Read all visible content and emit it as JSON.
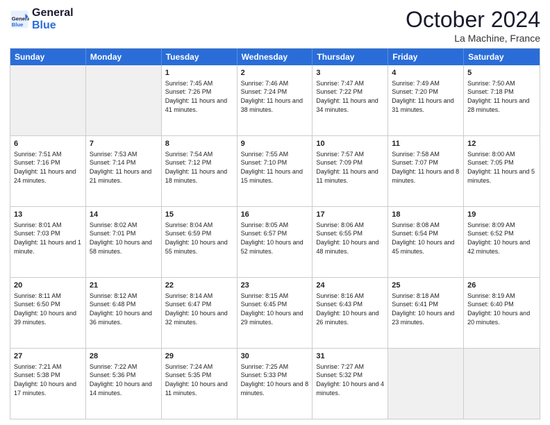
{
  "logo": {
    "line1": "General",
    "line2": "Blue"
  },
  "header": {
    "month": "October 2024",
    "location": "La Machine, France"
  },
  "days": [
    "Sunday",
    "Monday",
    "Tuesday",
    "Wednesday",
    "Thursday",
    "Friday",
    "Saturday"
  ],
  "rows": [
    [
      {
        "day": "",
        "info": ""
      },
      {
        "day": "",
        "info": ""
      },
      {
        "day": "1",
        "info": "Sunrise: 7:45 AM\nSunset: 7:26 PM\nDaylight: 11 hours and 41 minutes."
      },
      {
        "day": "2",
        "info": "Sunrise: 7:46 AM\nSunset: 7:24 PM\nDaylight: 11 hours and 38 minutes."
      },
      {
        "day": "3",
        "info": "Sunrise: 7:47 AM\nSunset: 7:22 PM\nDaylight: 11 hours and 34 minutes."
      },
      {
        "day": "4",
        "info": "Sunrise: 7:49 AM\nSunset: 7:20 PM\nDaylight: 11 hours and 31 minutes."
      },
      {
        "day": "5",
        "info": "Sunrise: 7:50 AM\nSunset: 7:18 PM\nDaylight: 11 hours and 28 minutes."
      }
    ],
    [
      {
        "day": "6",
        "info": "Sunrise: 7:51 AM\nSunset: 7:16 PM\nDaylight: 11 hours and 24 minutes."
      },
      {
        "day": "7",
        "info": "Sunrise: 7:53 AM\nSunset: 7:14 PM\nDaylight: 11 hours and 21 minutes."
      },
      {
        "day": "8",
        "info": "Sunrise: 7:54 AM\nSunset: 7:12 PM\nDaylight: 11 hours and 18 minutes."
      },
      {
        "day": "9",
        "info": "Sunrise: 7:55 AM\nSunset: 7:10 PM\nDaylight: 11 hours and 15 minutes."
      },
      {
        "day": "10",
        "info": "Sunrise: 7:57 AM\nSunset: 7:09 PM\nDaylight: 11 hours and 11 minutes."
      },
      {
        "day": "11",
        "info": "Sunrise: 7:58 AM\nSunset: 7:07 PM\nDaylight: 11 hours and 8 minutes."
      },
      {
        "day": "12",
        "info": "Sunrise: 8:00 AM\nSunset: 7:05 PM\nDaylight: 11 hours and 5 minutes."
      }
    ],
    [
      {
        "day": "13",
        "info": "Sunrise: 8:01 AM\nSunset: 7:03 PM\nDaylight: 11 hours and 1 minute."
      },
      {
        "day": "14",
        "info": "Sunrise: 8:02 AM\nSunset: 7:01 PM\nDaylight: 10 hours and 58 minutes."
      },
      {
        "day": "15",
        "info": "Sunrise: 8:04 AM\nSunset: 6:59 PM\nDaylight: 10 hours and 55 minutes."
      },
      {
        "day": "16",
        "info": "Sunrise: 8:05 AM\nSunset: 6:57 PM\nDaylight: 10 hours and 52 minutes."
      },
      {
        "day": "17",
        "info": "Sunrise: 8:06 AM\nSunset: 6:55 PM\nDaylight: 10 hours and 48 minutes."
      },
      {
        "day": "18",
        "info": "Sunrise: 8:08 AM\nSunset: 6:54 PM\nDaylight: 10 hours and 45 minutes."
      },
      {
        "day": "19",
        "info": "Sunrise: 8:09 AM\nSunset: 6:52 PM\nDaylight: 10 hours and 42 minutes."
      }
    ],
    [
      {
        "day": "20",
        "info": "Sunrise: 8:11 AM\nSunset: 6:50 PM\nDaylight: 10 hours and 39 minutes."
      },
      {
        "day": "21",
        "info": "Sunrise: 8:12 AM\nSunset: 6:48 PM\nDaylight: 10 hours and 36 minutes."
      },
      {
        "day": "22",
        "info": "Sunrise: 8:14 AM\nSunset: 6:47 PM\nDaylight: 10 hours and 32 minutes."
      },
      {
        "day": "23",
        "info": "Sunrise: 8:15 AM\nSunset: 6:45 PM\nDaylight: 10 hours and 29 minutes."
      },
      {
        "day": "24",
        "info": "Sunrise: 8:16 AM\nSunset: 6:43 PM\nDaylight: 10 hours and 26 minutes."
      },
      {
        "day": "25",
        "info": "Sunrise: 8:18 AM\nSunset: 6:41 PM\nDaylight: 10 hours and 23 minutes."
      },
      {
        "day": "26",
        "info": "Sunrise: 8:19 AM\nSunset: 6:40 PM\nDaylight: 10 hours and 20 minutes."
      }
    ],
    [
      {
        "day": "27",
        "info": "Sunrise: 7:21 AM\nSunset: 5:38 PM\nDaylight: 10 hours and 17 minutes."
      },
      {
        "day": "28",
        "info": "Sunrise: 7:22 AM\nSunset: 5:36 PM\nDaylight: 10 hours and 14 minutes."
      },
      {
        "day": "29",
        "info": "Sunrise: 7:24 AM\nSunset: 5:35 PM\nDaylight: 10 hours and 11 minutes."
      },
      {
        "day": "30",
        "info": "Sunrise: 7:25 AM\nSunset: 5:33 PM\nDaylight: 10 hours and 8 minutes."
      },
      {
        "day": "31",
        "info": "Sunrise: 7:27 AM\nSunset: 5:32 PM\nDaylight: 10 hours and 4 minutes."
      },
      {
        "day": "",
        "info": ""
      },
      {
        "day": "",
        "info": ""
      }
    ]
  ]
}
